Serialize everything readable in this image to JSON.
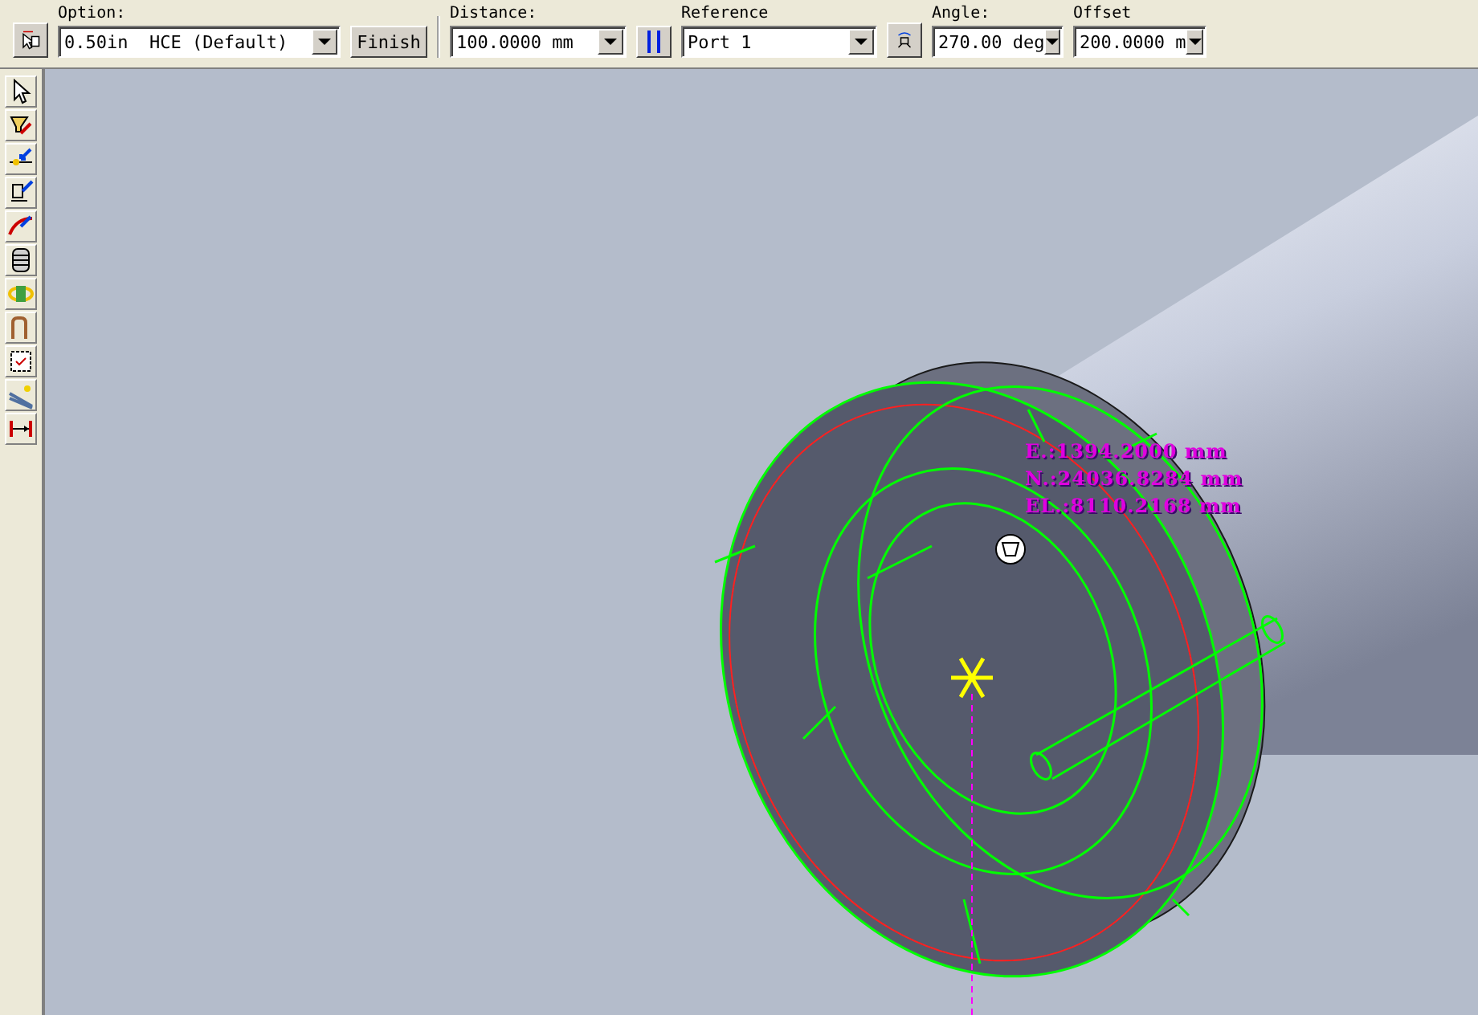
{
  "toolbar": {
    "option": {
      "label": "Option:",
      "value": "0.50in  HCE (Default)"
    },
    "finish_button": "Finish",
    "distance": {
      "label": "Distance:",
      "value": "100.0000 mm"
    },
    "reference": {
      "label": "Reference",
      "value": "Port 1"
    },
    "angle": {
      "label": "Angle:",
      "value": "270.00 deg"
    },
    "offset": {
      "label": "Offset",
      "value": "200.0000 m"
    }
  },
  "viewport": {
    "coordinates": [
      "E.:1394.2000 mm",
      "N.:24036.8284 mm",
      "EL.:8110.2168 mm"
    ]
  }
}
